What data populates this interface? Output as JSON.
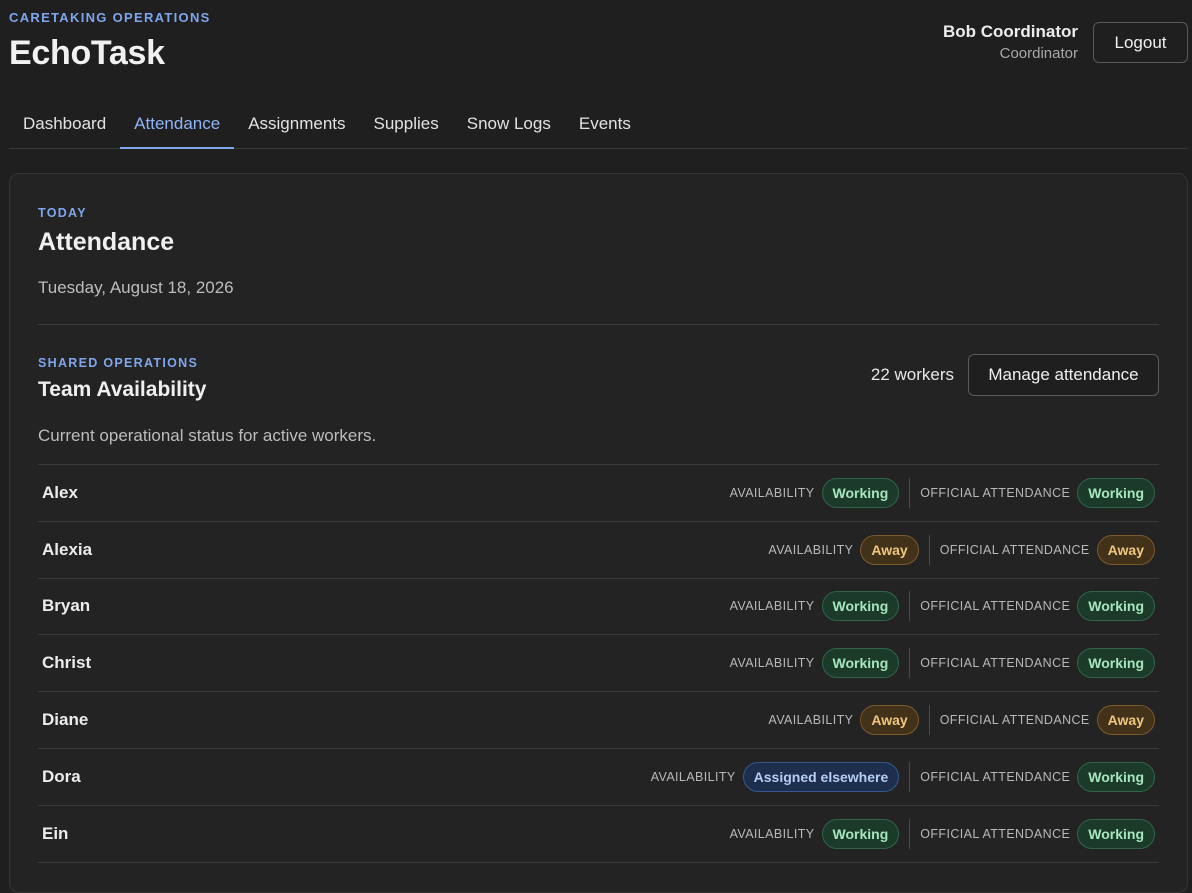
{
  "app": {
    "eyebrow": "CARETAKING OPERATIONS",
    "title": "EchoTask"
  },
  "user": {
    "name": "Bob Coordinator",
    "role": "Coordinator",
    "logout_label": "Logout"
  },
  "tabs": [
    {
      "label": "Dashboard",
      "active": false
    },
    {
      "label": "Attendance",
      "active": true
    },
    {
      "label": "Assignments",
      "active": false
    },
    {
      "label": "Supplies",
      "active": false
    },
    {
      "label": "Snow Logs",
      "active": false
    },
    {
      "label": "Events",
      "active": false
    }
  ],
  "page": {
    "eyebrow": "TODAY",
    "title": "Attendance",
    "date": "Tuesday, August 18, 2026"
  },
  "section": {
    "eyebrow": "SHARED OPERATIONS",
    "title": "Team Availability",
    "description": "Current operational status for active workers.",
    "worker_count": "22 workers",
    "manage_label": "Manage attendance",
    "availability_label": "AVAILABILITY",
    "official_label": "OFFICIAL ATTENDANCE"
  },
  "workers": [
    {
      "name": "Alex",
      "availability": "Working",
      "availability_kind": "working",
      "official": "Working",
      "official_kind": "working"
    },
    {
      "name": "Alexia",
      "availability": "Away",
      "availability_kind": "away",
      "official": "Away",
      "official_kind": "away"
    },
    {
      "name": "Bryan",
      "availability": "Working",
      "availability_kind": "working",
      "official": "Working",
      "official_kind": "working"
    },
    {
      "name": "Christ",
      "availability": "Working",
      "availability_kind": "working",
      "official": "Working",
      "official_kind": "working"
    },
    {
      "name": "Diane",
      "availability": "Away",
      "availability_kind": "away",
      "official": "Away",
      "official_kind": "away"
    },
    {
      "name": "Dora",
      "availability": "Assigned elsewhere",
      "availability_kind": "assigned",
      "official": "Working",
      "official_kind": "working"
    },
    {
      "name": "Ein",
      "availability": "Working",
      "availability_kind": "working",
      "official": "Working",
      "official_kind": "working"
    }
  ],
  "colors": {
    "accent": "#7fa6ec",
    "working": "#a6e6bd",
    "away": "#f0c77f",
    "assigned": "#b6cdf5"
  }
}
